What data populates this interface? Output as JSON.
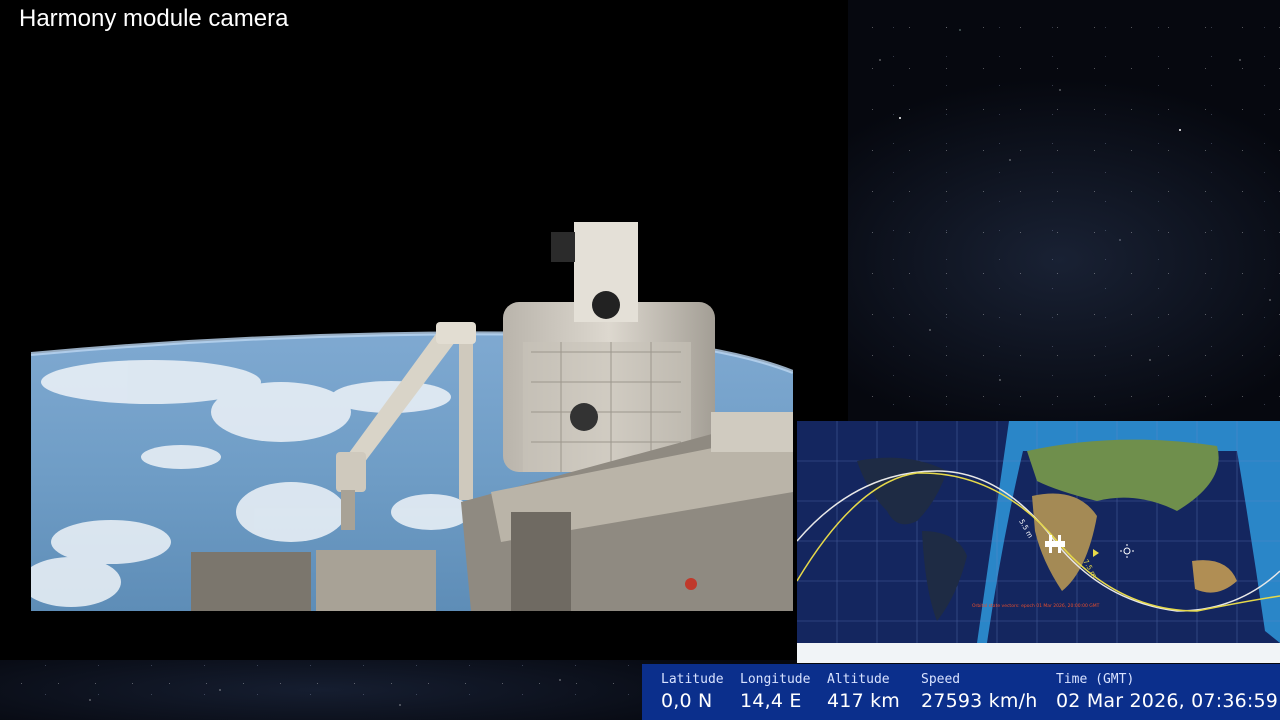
{
  "camera": {
    "title": "Harmony module camera"
  },
  "map": {
    "marker_labels": [
      "5.5 m",
      "7.5 m"
    ],
    "info_text": "Orbital state vectors: epoch 01 Mar 2026, 20:00:00 GMT",
    "colors": {
      "ocean_day": "#2a86c8",
      "ocean_night": "#14265f",
      "ground_track_current": "#e8e8e8",
      "ground_track_next": "#e6d94a",
      "ice": "#f1f4f7"
    }
  },
  "telemetry": {
    "latitude": {
      "label": "Latitude",
      "value": "0,0 N"
    },
    "longitude": {
      "label": "Longitude",
      "value": "14,4 E"
    },
    "altitude": {
      "label": "Altitude",
      "value": "417 km"
    },
    "speed": {
      "label": "Speed",
      "value": "27593 km/h"
    },
    "time": {
      "label": "Time (GMT)",
      "value": "02 Mar 2026, 07:36:59"
    }
  }
}
